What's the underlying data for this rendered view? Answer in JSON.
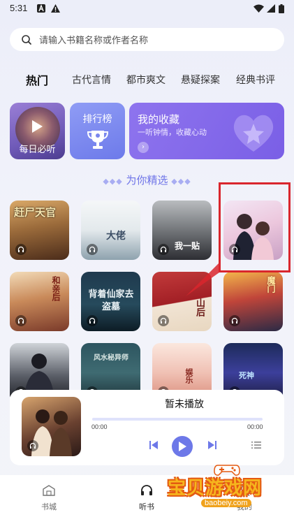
{
  "status_bar": {
    "time": "5:31"
  },
  "search": {
    "placeholder": "请输入书籍名称或作者名称"
  },
  "tabs": [
    {
      "label": "热门",
      "active": true
    },
    {
      "label": "古代言情",
      "active": false
    },
    {
      "label": "都市爽文",
      "active": false
    },
    {
      "label": "悬疑探案",
      "active": false
    },
    {
      "label": "经典书评",
      "active": false
    }
  ],
  "quick_cards": {
    "daily": {
      "label": "每日必听"
    },
    "ranking": {
      "label": "排行榜"
    },
    "favorites": {
      "title": "我的收藏",
      "subtitle": "一听钟情，收藏心动"
    }
  },
  "section": {
    "title": "为你精选"
  },
  "books": [
    {
      "cover_title": "赶尸天官"
    },
    {
      "cover_title": "大佬"
    },
    {
      "cover_title": "我一贴"
    },
    {
      "cover_title": ""
    },
    {
      "cover_title": "和亲后"
    },
    {
      "cover_title": "背着仙家去盗墓"
    },
    {
      "cover_title": "山后"
    },
    {
      "cover_title": "魔门"
    },
    {
      "cover_title": ""
    },
    {
      "cover_title": "风水秘异师"
    },
    {
      "cover_title": "娱乐"
    },
    {
      "cover_title": "死神"
    }
  ],
  "player": {
    "title": "暂未播放",
    "time_current": "00:00",
    "time_total": "00:00",
    "progress": 0
  },
  "bottom_nav": [
    {
      "label": "书城",
      "icon": "bookstore-icon",
      "active": false
    },
    {
      "label": "听书",
      "icon": "headphones-icon",
      "active": true
    },
    {
      "label": "我的",
      "icon": "profile-icon",
      "active": false
    }
  ],
  "watermark": {
    "text": "宝贝游戏网",
    "url": "baobeiy.com"
  },
  "colors": {
    "accent": "#6d78e8",
    "highlight_box": "#d9262d"
  }
}
